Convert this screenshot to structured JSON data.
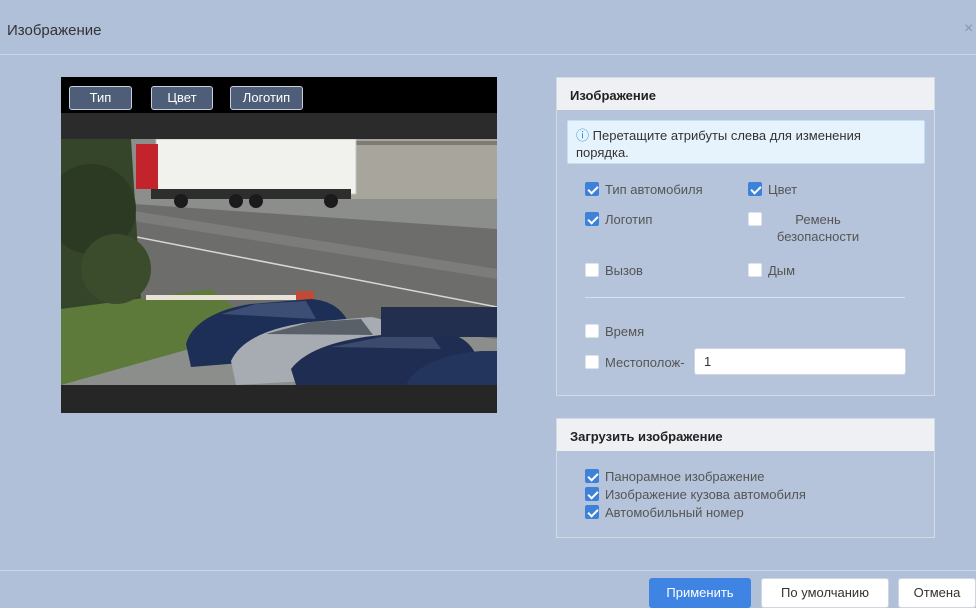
{
  "dialog": {
    "title": "Изображение",
    "close_glyph": "×"
  },
  "preview": {
    "tags": [
      "Тип",
      "Цвет",
      "Логотип"
    ]
  },
  "image_panel": {
    "title": "Изображение",
    "notice_icon": "info-circle-icon",
    "notice_glyph": "ⓘ",
    "notice_text": "Перетащите атрибуты слева для изменения порядка.",
    "options": [
      {
        "label": "Тип автомобиля",
        "checked": true
      },
      {
        "label": "Цвет",
        "checked": true
      },
      {
        "label": "Логотип",
        "checked": true
      },
      {
        "label": "Ремень безопасности",
        "checked": false
      },
      {
        "label": "Вызов",
        "checked": false
      },
      {
        "label": "Дым",
        "checked": false
      },
      {
        "label": "Время",
        "checked": false
      },
      {
        "label": "Местополож-",
        "checked": false
      }
    ],
    "location_value": "1"
  },
  "upload_panel": {
    "title": "Загрузить изображение",
    "options": [
      {
        "label": "Панорамное изображение",
        "checked": true
      },
      {
        "label": "Изображение кузова автомобиля",
        "checked": true
      },
      {
        "label": "Автомобильный номер",
        "checked": true
      }
    ]
  },
  "footer": {
    "apply_label": "Применить",
    "default_label": "По умолчанию",
    "cancel_label": "Отмена"
  },
  "colors": {
    "accent": "#3f84e3",
    "background": "#b0c0d8",
    "checkbox": "#3d82d8"
  }
}
